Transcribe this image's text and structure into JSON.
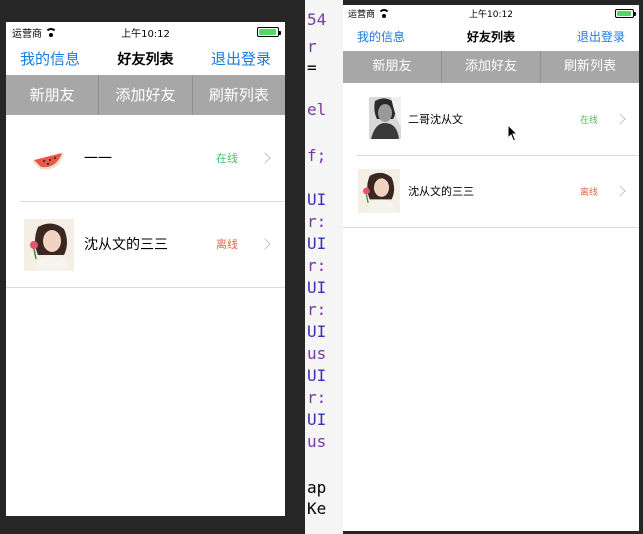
{
  "status_bar": {
    "carrier": "运营商",
    "time": "上午10:12"
  },
  "nav": {
    "left": "我的信息",
    "title": "好友列表",
    "right": "退出登录"
  },
  "segments": [
    "新朋友",
    "添加好友",
    "刷新列表"
  ],
  "left_phone": {
    "friends": [
      {
        "name": "一一",
        "status": "在线",
        "status_color": "#4cc05f"
      },
      {
        "name": "沈从文的三三",
        "status": "离线",
        "status_color": "#e06a4d"
      }
    ]
  },
  "right_phone": {
    "friends": [
      {
        "name": "二哥沈从文",
        "status": "在线",
        "status_color": "#4cc05f"
      },
      {
        "name": "沈从文的三三",
        "status": "离线",
        "status_color": "#e06a4d"
      }
    ]
  },
  "editor": {
    "lines": [
      "54",
      "r",
      "=",
      "el",
      "f;",
      "UI",
      "r:",
      "UI",
      "r:",
      "UI",
      "r:",
      "UI",
      "us",
      "UI",
      "r:",
      "UI",
      "us",
      "ap",
      "Ke"
    ]
  }
}
